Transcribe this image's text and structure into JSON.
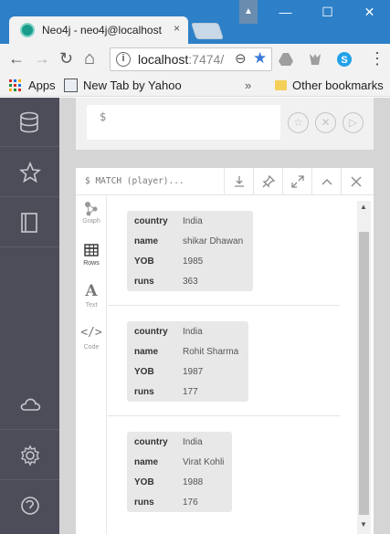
{
  "window": {
    "tab_title": "Neo4j - neo4j@localhost",
    "tab_close": "×",
    "min_glyph": "—",
    "max_glyph": "☐",
    "close_glyph": "✕",
    "user_glyph": "▲"
  },
  "toolbar": {
    "back_glyph": "←",
    "forward_glyph": "→",
    "reload_glyph": "↻",
    "home_glyph": "⌂",
    "menu_glyph": "⋮",
    "url_host": "localhost",
    "url_path": ":7474/",
    "zoom_glyph": "⊖",
    "star_glyph": "★",
    "star_color": "#3a7ad6"
  },
  "bookmarks": {
    "apps_label": "Apps",
    "yahoo_label": "New Tab by Yahoo",
    "overflow_glyph": "»",
    "other_label": "Other bookmarks"
  },
  "sidebar": {
    "items": [
      "database-icon",
      "star-icon",
      "document-icon",
      "cloud-icon",
      "gear-icon",
      "about-icon"
    ],
    "background": "#4d4d59"
  },
  "editor": {
    "prompt": "$",
    "buttons": [
      "☆",
      "✕",
      "▷"
    ]
  },
  "frame": {
    "query": "$ MATCH (player)..."
  },
  "views": [
    {
      "label": "Graph",
      "icon": "graph-icon"
    },
    {
      "label": "Rows",
      "icon": "table-icon"
    },
    {
      "label": "Text",
      "glyph": "A"
    },
    {
      "label": "Code",
      "glyph": "</>"
    }
  ],
  "records": [
    {
      "fields": [
        {
          "key": "country",
          "value": "India"
        },
        {
          "key": "name",
          "value": "shikar Dhawan"
        },
        {
          "key": "YOB",
          "value": "1985"
        },
        {
          "key": "runs",
          "value": "363"
        }
      ]
    },
    {
      "fields": [
        {
          "key": "country",
          "value": "India"
        },
        {
          "key": "name",
          "value": "Rohit Sharma"
        },
        {
          "key": "YOB",
          "value": "1987"
        },
        {
          "key": "runs",
          "value": "177"
        }
      ]
    },
    {
      "fields": [
        {
          "key": "country",
          "value": "India"
        },
        {
          "key": "name",
          "value": "Virat Kohli"
        },
        {
          "key": "YOB",
          "value": "1988"
        },
        {
          "key": "runs",
          "value": "176"
        }
      ]
    }
  ],
  "scrollbar": {
    "up_glyph": "▲",
    "down_glyph": "▼"
  }
}
